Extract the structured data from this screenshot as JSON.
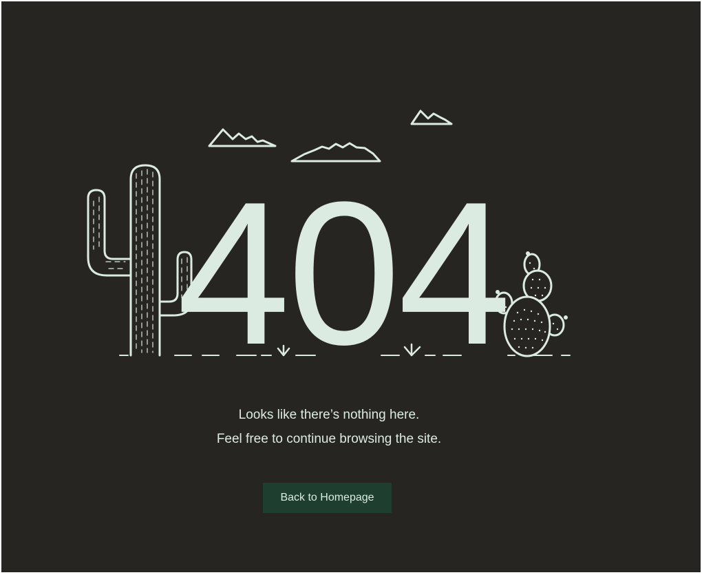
{
  "error": {
    "code": "404",
    "line1": "Looks like there’s nothing here.",
    "line2": "Feel free to continue browsing the site."
  },
  "actions": {
    "home_label": "Back to Homepage"
  },
  "colors": {
    "background": "#272522",
    "foreground": "#dcebe1",
    "button": "#1e3e2f"
  },
  "illustration": {
    "icons": [
      "saguaro-cactus-icon",
      "prickly-pear-cactus-icon",
      "mountain-icon",
      "grass-tuft-icon"
    ]
  }
}
